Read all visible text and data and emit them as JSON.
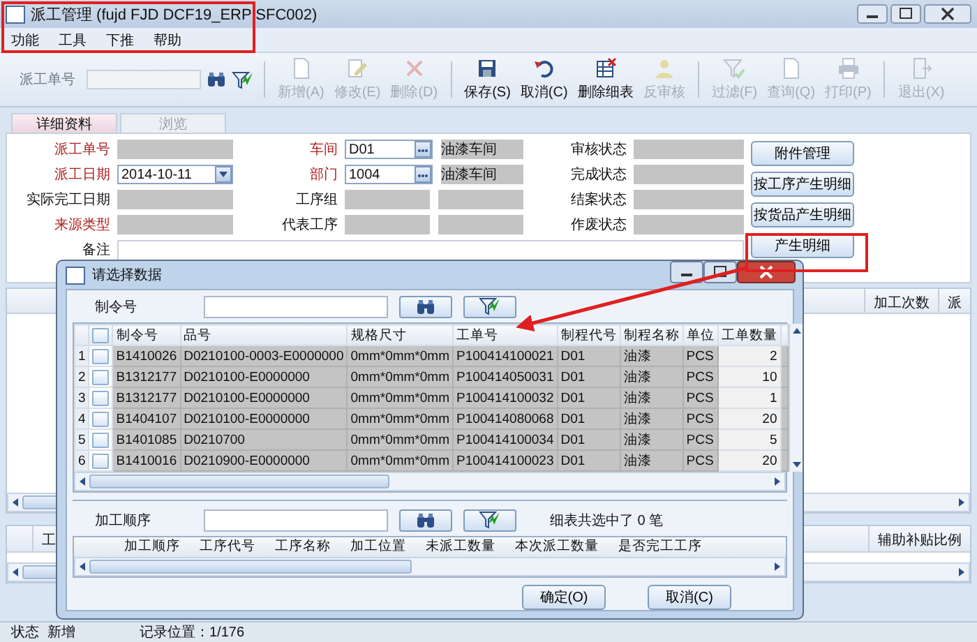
{
  "window": {
    "title": "派工管理 (fujd FJD DCF19_ERP SFC002)"
  },
  "menu": [
    "功能",
    "工具",
    "下推",
    "帮助"
  ],
  "toolbar": {
    "search_label": "派工单号",
    "buttons": [
      {
        "label": "新增(A)",
        "disabled": true
      },
      {
        "label": "修改(E)",
        "disabled": true
      },
      {
        "label": "删除(D)",
        "disabled": true
      },
      {
        "label": "保存(S)",
        "disabled": false
      },
      {
        "label": "取消(C)",
        "disabled": false
      },
      {
        "label": "删除细表",
        "disabled": false
      },
      {
        "label": "反审核",
        "disabled": true
      },
      {
        "label": "过滤(F)",
        "disabled": true
      },
      {
        "label": "查询(Q)",
        "disabled": true
      },
      {
        "label": "打印(P)",
        "disabled": true
      },
      {
        "label": "退出(X)",
        "disabled": true
      }
    ]
  },
  "tabs": [
    {
      "label": "详细资料",
      "selected": true
    },
    {
      "label": "浏览",
      "selected": false
    }
  ],
  "form": {
    "rows": [
      [
        {
          "label": "派工单号",
          "required": true,
          "kind": "text"
        },
        {
          "label": "车间",
          "required": true,
          "kind": "lookup",
          "value": "D01",
          "name": "油漆车间"
        },
        {
          "label": "审核状态",
          "required": false,
          "kind": "text"
        }
      ],
      [
        {
          "label": "派工日期",
          "required": true,
          "kind": "date",
          "value": "2014-10-11"
        },
        {
          "label": "部门",
          "required": true,
          "kind": "lookup",
          "value": "1004",
          "name": "油漆车间"
        },
        {
          "label": "完成状态",
          "required": false,
          "kind": "text"
        }
      ],
      [
        {
          "label": "实际完工日期",
          "required": false,
          "kind": "text"
        },
        {
          "label": "工序组",
          "required": false,
          "kind": "pair"
        },
        {
          "label": "结案状态",
          "required": false,
          "kind": "text"
        }
      ],
      [
        {
          "label": "来源类型",
          "required": true,
          "kind": "text"
        },
        {
          "label": "代表工序",
          "required": false,
          "kind": "pair"
        },
        {
          "label": "作废状态",
          "required": false,
          "kind": "text"
        }
      ]
    ],
    "remark": {
      "label": "备注"
    },
    "buttons": [
      "附件管理",
      "按工序产生明细",
      "按货品产生明细",
      "产生明细"
    ]
  },
  "main_grid": {
    "columns": [
      "加工次数",
      "派"
    ]
  },
  "detail_grid": {
    "columns": [
      "工",
      "辅助补贴比例"
    ]
  },
  "dialog": {
    "title": "请选择数据",
    "filter_label": "制令号",
    "all_checked": false,
    "columns": [
      "制令号",
      "品号",
      "规格尺寸",
      "工单号",
      "制程代号",
      "制程名称",
      "单位",
      "工单数量"
    ],
    "rows": [
      {
        "no": "1",
        "checked": false,
        "cells": [
          "B1410026",
          "D0210100-0003-E0000000",
          "0mm*0mm*0mm",
          "P100414100021",
          "D01",
          "油漆",
          "PCS",
          "2"
        ]
      },
      {
        "no": "2",
        "checked": false,
        "cells": [
          "B1312177",
          "D0210100-E0000000",
          "0mm*0mm*0mm",
          "P100414050031",
          "D01",
          "油漆",
          "PCS",
          "10"
        ]
      },
      {
        "no": "3",
        "checked": false,
        "cells": [
          "B1312177",
          "D0210100-E0000000",
          "0mm*0mm*0mm",
          "P100414100032",
          "D01",
          "油漆",
          "PCS",
          "1"
        ]
      },
      {
        "no": "4",
        "checked": false,
        "cells": [
          "B1404107",
          "D0210100-E0000000",
          "0mm*0mm*0mm",
          "P100414080068",
          "D01",
          "油漆",
          "PCS",
          "20"
        ]
      },
      {
        "no": "5",
        "checked": false,
        "cells": [
          "B1401085",
          "D0210700",
          "0mm*0mm*0mm",
          "P100414100034",
          "D01",
          "油漆",
          "PCS",
          "5"
        ]
      },
      {
        "no": "6",
        "checked": false,
        "cells": [
          "B1410016",
          "D0210900-E0000000",
          "0mm*0mm*0mm",
          "P100414100023",
          "D01",
          "油漆",
          "PCS",
          "20"
        ]
      }
    ],
    "detail_filter_label": "加工顺序",
    "selection_note": "细表共选中了 0 笔",
    "detail_columns": [
      "加工顺序",
      "工序代号",
      "工序名称",
      "加工位置",
      "未派工数量",
      "本次派工数量",
      "是否完工工序"
    ],
    "buttons": [
      "确定(O)",
      "取消(C)"
    ]
  },
  "status_bar": {
    "label": "状态",
    "value": "新增",
    "record": "记录位置：1/176"
  }
}
